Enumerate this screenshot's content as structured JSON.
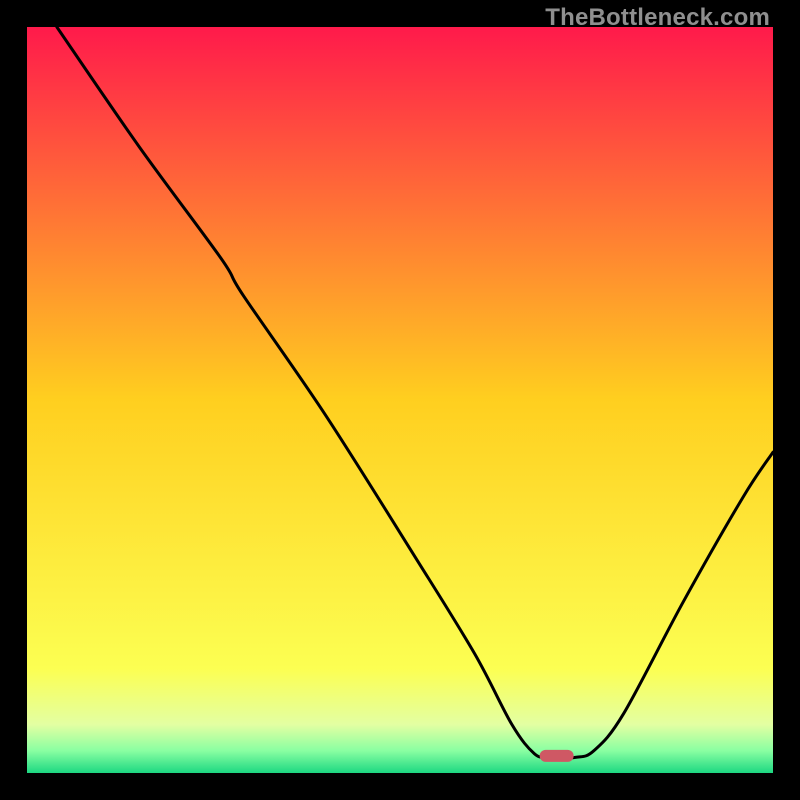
{
  "watermark": "TheBottleneck.com",
  "chart_data": {
    "type": "line",
    "title": "",
    "xlabel": "",
    "ylabel": "",
    "xlim": [
      0,
      100
    ],
    "ylim": [
      0,
      100
    ],
    "background_gradient": [
      {
        "t": 0.0,
        "color": "#ff1a4b"
      },
      {
        "t": 0.5,
        "color": "#ffcf1f"
      },
      {
        "t": 0.86,
        "color": "#fcff52"
      },
      {
        "t": 0.935,
        "color": "#e3ffa2"
      },
      {
        "t": 0.97,
        "color": "#8affa2"
      },
      {
        "t": 1.0,
        "color": "#1dd882"
      }
    ],
    "marker": {
      "x": 71,
      "y": 2.3,
      "color": "#cf5864"
    },
    "curve_points": [
      {
        "x": 4.0,
        "y": 100.0
      },
      {
        "x": 15.0,
        "y": 84.0
      },
      {
        "x": 26.0,
        "y": 69.0
      },
      {
        "x": 29.0,
        "y": 64.0
      },
      {
        "x": 40.0,
        "y": 48.0
      },
      {
        "x": 52.0,
        "y": 29.0
      },
      {
        "x": 60.0,
        "y": 16.0
      },
      {
        "x": 65.0,
        "y": 6.5
      },
      {
        "x": 68.0,
        "y": 2.6
      },
      {
        "x": 70.0,
        "y": 2.1
      },
      {
        "x": 73.5,
        "y": 2.1
      },
      {
        "x": 76.0,
        "y": 3.0
      },
      {
        "x": 80.0,
        "y": 8.0
      },
      {
        "x": 88.0,
        "y": 23.0
      },
      {
        "x": 96.0,
        "y": 37.0
      },
      {
        "x": 100.0,
        "y": 43.0
      }
    ]
  }
}
